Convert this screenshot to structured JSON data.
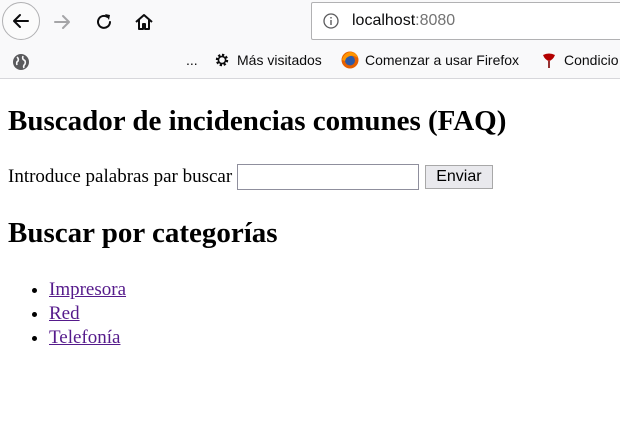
{
  "browser": {
    "icons": {
      "back": "back-arrow-icon",
      "forward": "forward-arrow-icon",
      "reload": "reload-icon",
      "home": "home-icon",
      "info": "info-icon",
      "globe": "globe-icon"
    },
    "url": {
      "host": "localhost",
      "port": ":8080"
    },
    "bookmarks": {
      "overflow": "...",
      "items": [
        {
          "label": "Más visitados",
          "icon": "gear-icon"
        },
        {
          "label": "Comenzar a usar Firefox",
          "icon": "firefox-icon"
        },
        {
          "label": "Condicio",
          "icon": "bookmark-icon"
        }
      ]
    }
  },
  "page": {
    "title": "Buscador de incidencias comunes (FAQ)",
    "search": {
      "label": "Introduce palabras par buscar",
      "value": "",
      "button": "Enviar"
    },
    "categories": {
      "heading": "Buscar por categorías",
      "items": [
        "Impresora",
        "Red",
        "Telefonía"
      ]
    },
    "colors": {
      "visited_link": "#551a8b"
    }
  }
}
